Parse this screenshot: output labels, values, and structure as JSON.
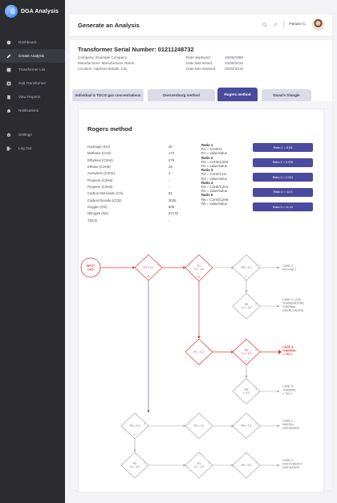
{
  "app": {
    "name": "DGA Analysis"
  },
  "sidebar": {
    "items": [
      {
        "label": "Dashboard",
        "icon": "dashboard-icon"
      },
      {
        "label": "Create Analysis",
        "icon": "edit-icon",
        "active": true
      },
      {
        "label": "Transformer List",
        "icon": "list-icon"
      },
      {
        "label": "Add Transformer",
        "icon": "add-icon"
      },
      {
        "label": "View Reports",
        "icon": "report-icon"
      },
      {
        "label": "Notifications",
        "icon": "bell-icon"
      }
    ],
    "bottom_items": [
      {
        "label": "Settings",
        "icon": "gear-icon"
      },
      {
        "label": "Log Out",
        "icon": "logout-icon"
      }
    ]
  },
  "header": {
    "title": "Generate an Analysis",
    "user_name": "Panaro C.",
    "icons": [
      "search-icon",
      "settings-icon"
    ]
  },
  "transformer": {
    "serial_label": "Transformer Serial Number: 01211248732",
    "company": "Company: Example Company",
    "manufacturer": "Manufacturer: Manufacturer Name",
    "location": "Location: Address details, City",
    "date_deployed_label": "Date deployed:",
    "date_deployed": "10/06/1999",
    "date_last_tested_label": "Date last tested:",
    "date_last_tested": "14/09/2019",
    "date_last_repaired_label": "Date last repaired:",
    "date_last_repaired": "02/04/2010"
  },
  "tabs": [
    {
      "label": "Individual & TDCG gas concentrations",
      "active": false
    },
    {
      "label": "Doernenburg method",
      "active": false
    },
    {
      "label": "Rogers method",
      "active": true
    },
    {
      "label": "Duval's triangle",
      "active": false
    }
  ],
  "rogers": {
    "title": "Rogers method",
    "gases": [
      {
        "name": "Hydrogen (H2)",
        "value": "20"
      },
      {
        "name": "Methane (CH4)",
        "value": "173"
      },
      {
        "name": "Ethylene (C2H4)",
        "value": "279"
      },
      {
        "name": "Ethane (C2H6)",
        "value": "25"
      },
      {
        "name": "Acetylene (C2H2)",
        "value": "2"
      },
      {
        "name": "Propene (C3H6)",
        "value": "-"
      },
      {
        "name": "Propene (C3H6)",
        "value": "-"
      },
      {
        "name": "Carbon Monoxide (CO)",
        "value": "82"
      },
      {
        "name": "Carbon Dioxide (CO2)",
        "value": "3025"
      },
      {
        "name": "Oxygen (O2)",
        "value": "605"
      },
      {
        "name": "Nitrogen (N2)",
        "value": "67175"
      },
      {
        "name": "TDCG",
        "value": "-"
      }
    ],
    "ratios": [
      {
        "title": "Ratio 1",
        "formula": "R1 = CH4/H2",
        "value_line": "R1 = value/value",
        "pill": "Ratio 1 = 8.54"
      },
      {
        "title": "Ratio 2",
        "formula": "R2 = C2H2/C2H4",
        "value_line": "R2 = value/value",
        "pill": "Ratio 2 = 0.005"
      },
      {
        "title": "Ratio 3",
        "formula": "R3 = C2H2/CH4",
        "value_line": "R3 = value/value",
        "pill": "Ratio 3 = 0.001"
      },
      {
        "title": "Ratio 4",
        "formula": "R4 = C2H6/C2H2",
        "value_line": "R4 = value/value",
        "pill": "Ratio 4 = 12.5"
      },
      {
        "title": "Ratio 5",
        "formula": "R5 = C2H4/C2H6",
        "value_line": "R5 = value/value",
        "pill": "Ratio 5 = 11.12"
      }
    ]
  },
  "flow": {
    "start": [
      "INPUT",
      "GAS"
    ],
    "diamonds": {
      "a": [
        "R2 < 0.1"
      ],
      "b": [
        "R1",
        "0.1 - 1.0"
      ],
      "c": [
        "R5 < 1.0"
      ],
      "d": [
        "R5",
        "1.0 - 3.0"
      ],
      "e": [
        "R1 > 1.0"
      ],
      "f": [
        "R5",
        "1.0 - 3.0"
      ],
      "g": [
        "R5",
        "> 3.0"
      ],
      "h": [
        "R2 > 0.1"
      ],
      "i": [
        "R2 > 0.1"
      ],
      "j": [
        "R5 < 1.0"
      ],
      "k": [
        "R2",
        "0.1 - 3.0"
      ],
      "l": [
        "R1",
        "0.1 - 1.0"
      ],
      "m": [
        "R5 > 3.0"
      ]
    },
    "yes": "Y",
    "no": "N",
    "cases": {
      "c0": [
        "CASE 0:",
        "NO FAULT"
      ],
      "c3": [
        "CASE 3: LOW",
        "TEMPERATURE",
        "THERMAL",
        "OVERLOADING"
      ],
      "c4": [
        "CASE 4:",
        "THERMAL",
        "< 700 C"
      ],
      "c5": [
        "CASE 5:",
        "THERMAL",
        "> 700 C"
      ],
      "c1": [
        "CASE 1:",
        "PARTIAL",
        "DISCHARGE"
      ],
      "c2": [
        "CASE 2:",
        "HIGH-ENERGY",
        "DISCHARGE"
      ]
    },
    "colors": {
      "normal": "#9a9aa6",
      "highlight": "#e03a3a",
      "accent": "#4a4a9e"
    }
  }
}
